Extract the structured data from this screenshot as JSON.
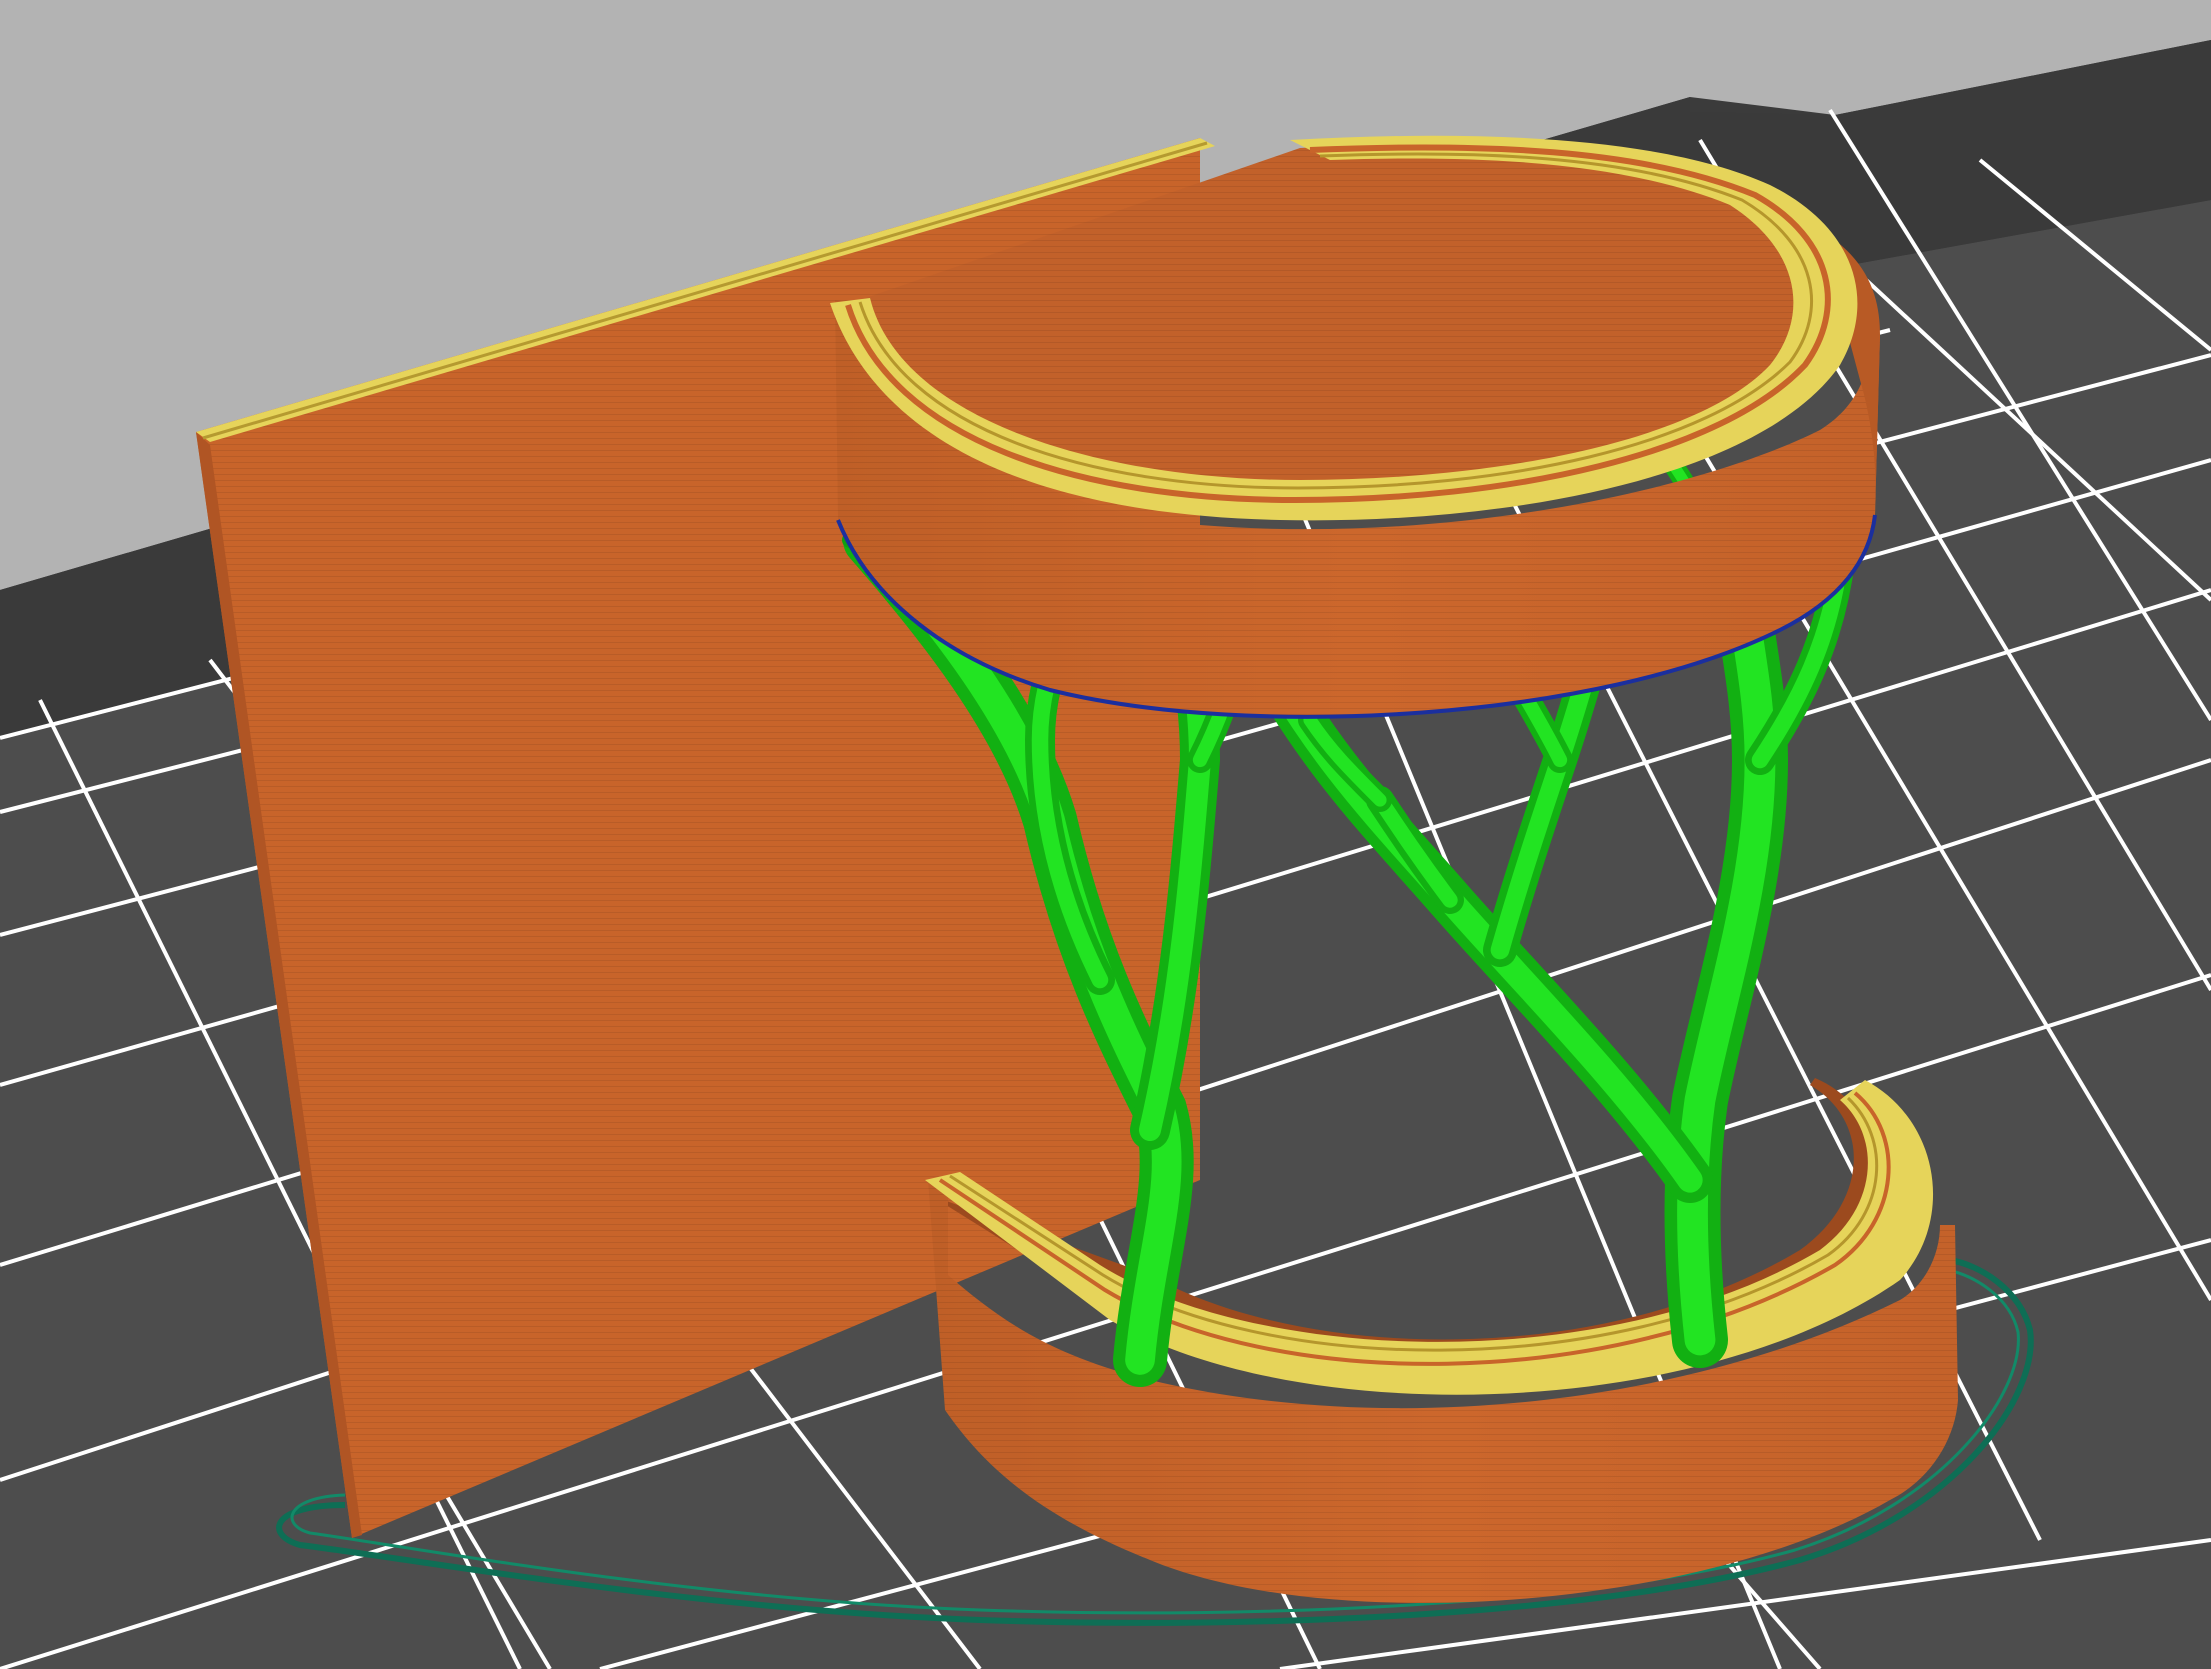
{
  "viewport": {
    "background_color": "#b3b3b3",
    "bed_color": "#4a4a4a",
    "bed_shadow_color": "#3a3a3a",
    "grid_line_color": "#ffffff"
  },
  "model": {
    "perimeter_color": "#c8642a",
    "perimeter_dark": "#b35a26",
    "top_edge_color": "#e6d45a",
    "top_edge_inner": "#c2a83a",
    "support_color": "#1ee01e",
    "support_dark": "#10b410",
    "interface_color": "#1b2f9e",
    "skirt_color": "#0e6e55"
  },
  "icons": {
    "bed": "print-bed-grid",
    "support": "tree-support"
  }
}
